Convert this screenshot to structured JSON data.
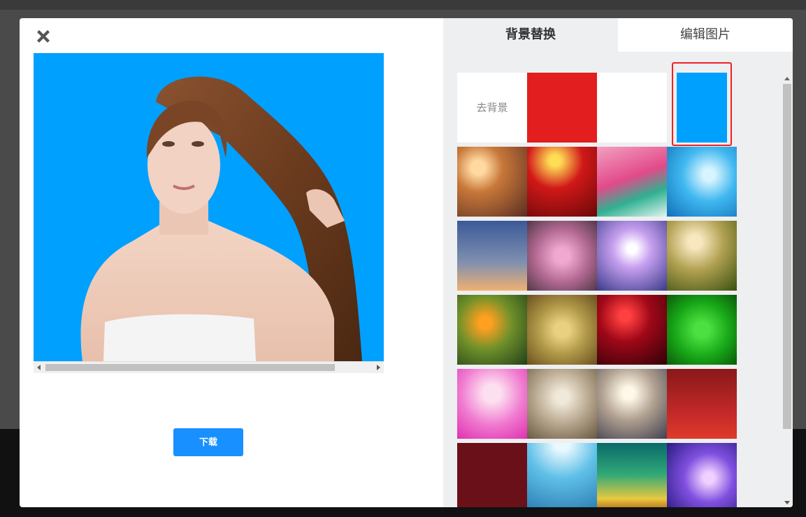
{
  "dialog": {
    "download_label": "下载",
    "close_icon": "close-x-icon"
  },
  "tabs": [
    {
      "label": "背景替换",
      "active": true
    },
    {
      "label": "编辑图片",
      "active": false
    }
  ],
  "backgrounds": {
    "remove_label": "去背景",
    "solid_colors": [
      "#e21e1e",
      "#ffffff",
      "#00a0ff"
    ],
    "selected_index": 3
  },
  "colors": {
    "accent": "#1890ff",
    "preview_bg": "#00a0ff",
    "selection": "#ee2222"
  }
}
